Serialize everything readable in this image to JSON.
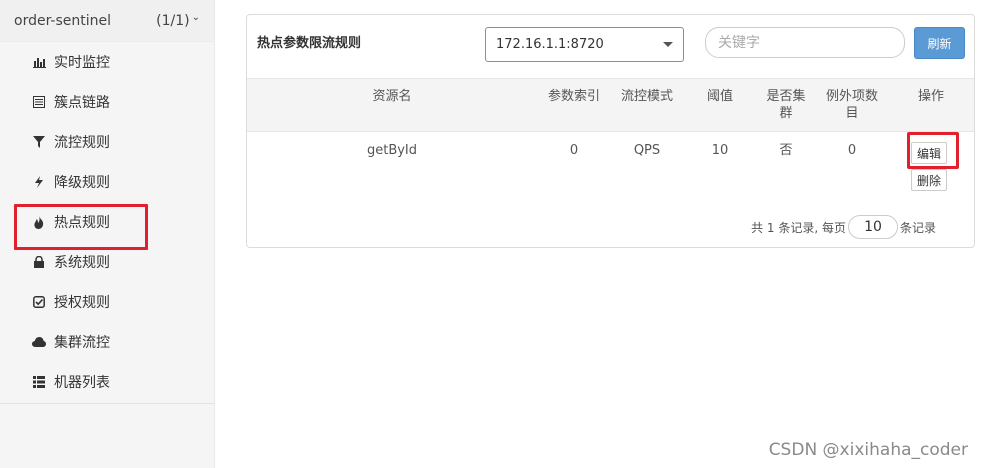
{
  "app": {
    "name": "order-sentinel",
    "count": "(1/1)",
    "chevron": "chevron-down-icon"
  },
  "sidebar": {
    "items": [
      {
        "label": "实时监控",
        "icon": "bar-chart-icon"
      },
      {
        "label": "簇点链路",
        "icon": "list-icon"
      },
      {
        "label": "流控规则",
        "icon": "filter-icon"
      },
      {
        "label": "降级规则",
        "icon": "flash-icon"
      },
      {
        "label": "热点规则",
        "icon": "fire-icon",
        "active": true
      },
      {
        "label": "系统规则",
        "icon": "lock-icon"
      },
      {
        "label": "授权规则",
        "icon": "check-icon"
      },
      {
        "label": "集群流控",
        "icon": "cloud-icon"
      },
      {
        "label": "机器列表",
        "icon": "th-list-icon"
      }
    ]
  },
  "panel": {
    "title": "热点参数限流规则",
    "machine": "172.16.1.1:8720",
    "search_placeholder": "关键字",
    "refresh_label": "刷新"
  },
  "table": {
    "headers": {
      "resource": "资源名",
      "param_index": "参数索引",
      "mode": "流控模式",
      "threshold": "阈值",
      "cluster": "是否集\n群",
      "exceptions": "例外项数\n目",
      "actions": "操作"
    },
    "rows": [
      {
        "resource": "getById",
        "param_index": "0",
        "mode": "QPS",
        "threshold": "10",
        "cluster": "否",
        "exceptions": "0",
        "edit": "编辑",
        "delete": "删除"
      }
    ]
  },
  "pager": {
    "prefix": "共 1 条记录, 每页",
    "page_size": "10",
    "suffix": "条记录"
  },
  "watermark": "CSDN @xixihaha_coder",
  "colors": {
    "accent": "#5b9bd5",
    "highlight": "#e0212d"
  }
}
